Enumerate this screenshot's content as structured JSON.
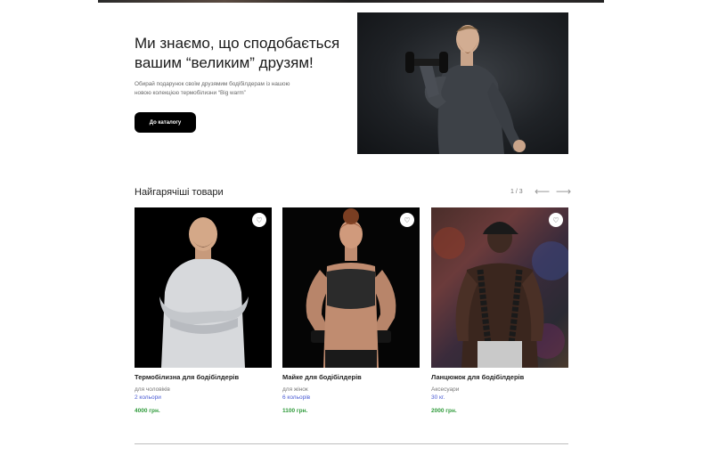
{
  "hero": {
    "title": "Ми знаємо, що сподобається вашим “великим” друзям!",
    "subtitle": "Обирай подарунок своїм друзямим бодібілдерам із нашою новою колекцією термобілизни “Big warm”",
    "button_label": "До каталогу"
  },
  "hot": {
    "title": "Найгарячіші товари",
    "pager": "1 / 3",
    "prev_arrow": "⟵",
    "next_arrow": "⟶"
  },
  "products": [
    {
      "name": "Термобілизна для бодібілдерів",
      "category": "для чоловіків",
      "variant": "2 кольори",
      "price": "4000 грн."
    },
    {
      "name": "Майке для бодібілдерів",
      "category": "для жінок",
      "variant": "6 кольорів",
      "price": "1100 грн."
    },
    {
      "name": "Ланцюжок для бодібілдерів",
      "category": "Аксесуари",
      "variant": "30 кг.",
      "price": "2000 грн."
    }
  ],
  "icons": {
    "favorite": "heart-icon"
  },
  "colors": {
    "accent_variant": "#4a5bd4",
    "price": "#2e9a3a",
    "button_bg": "#000000"
  }
}
